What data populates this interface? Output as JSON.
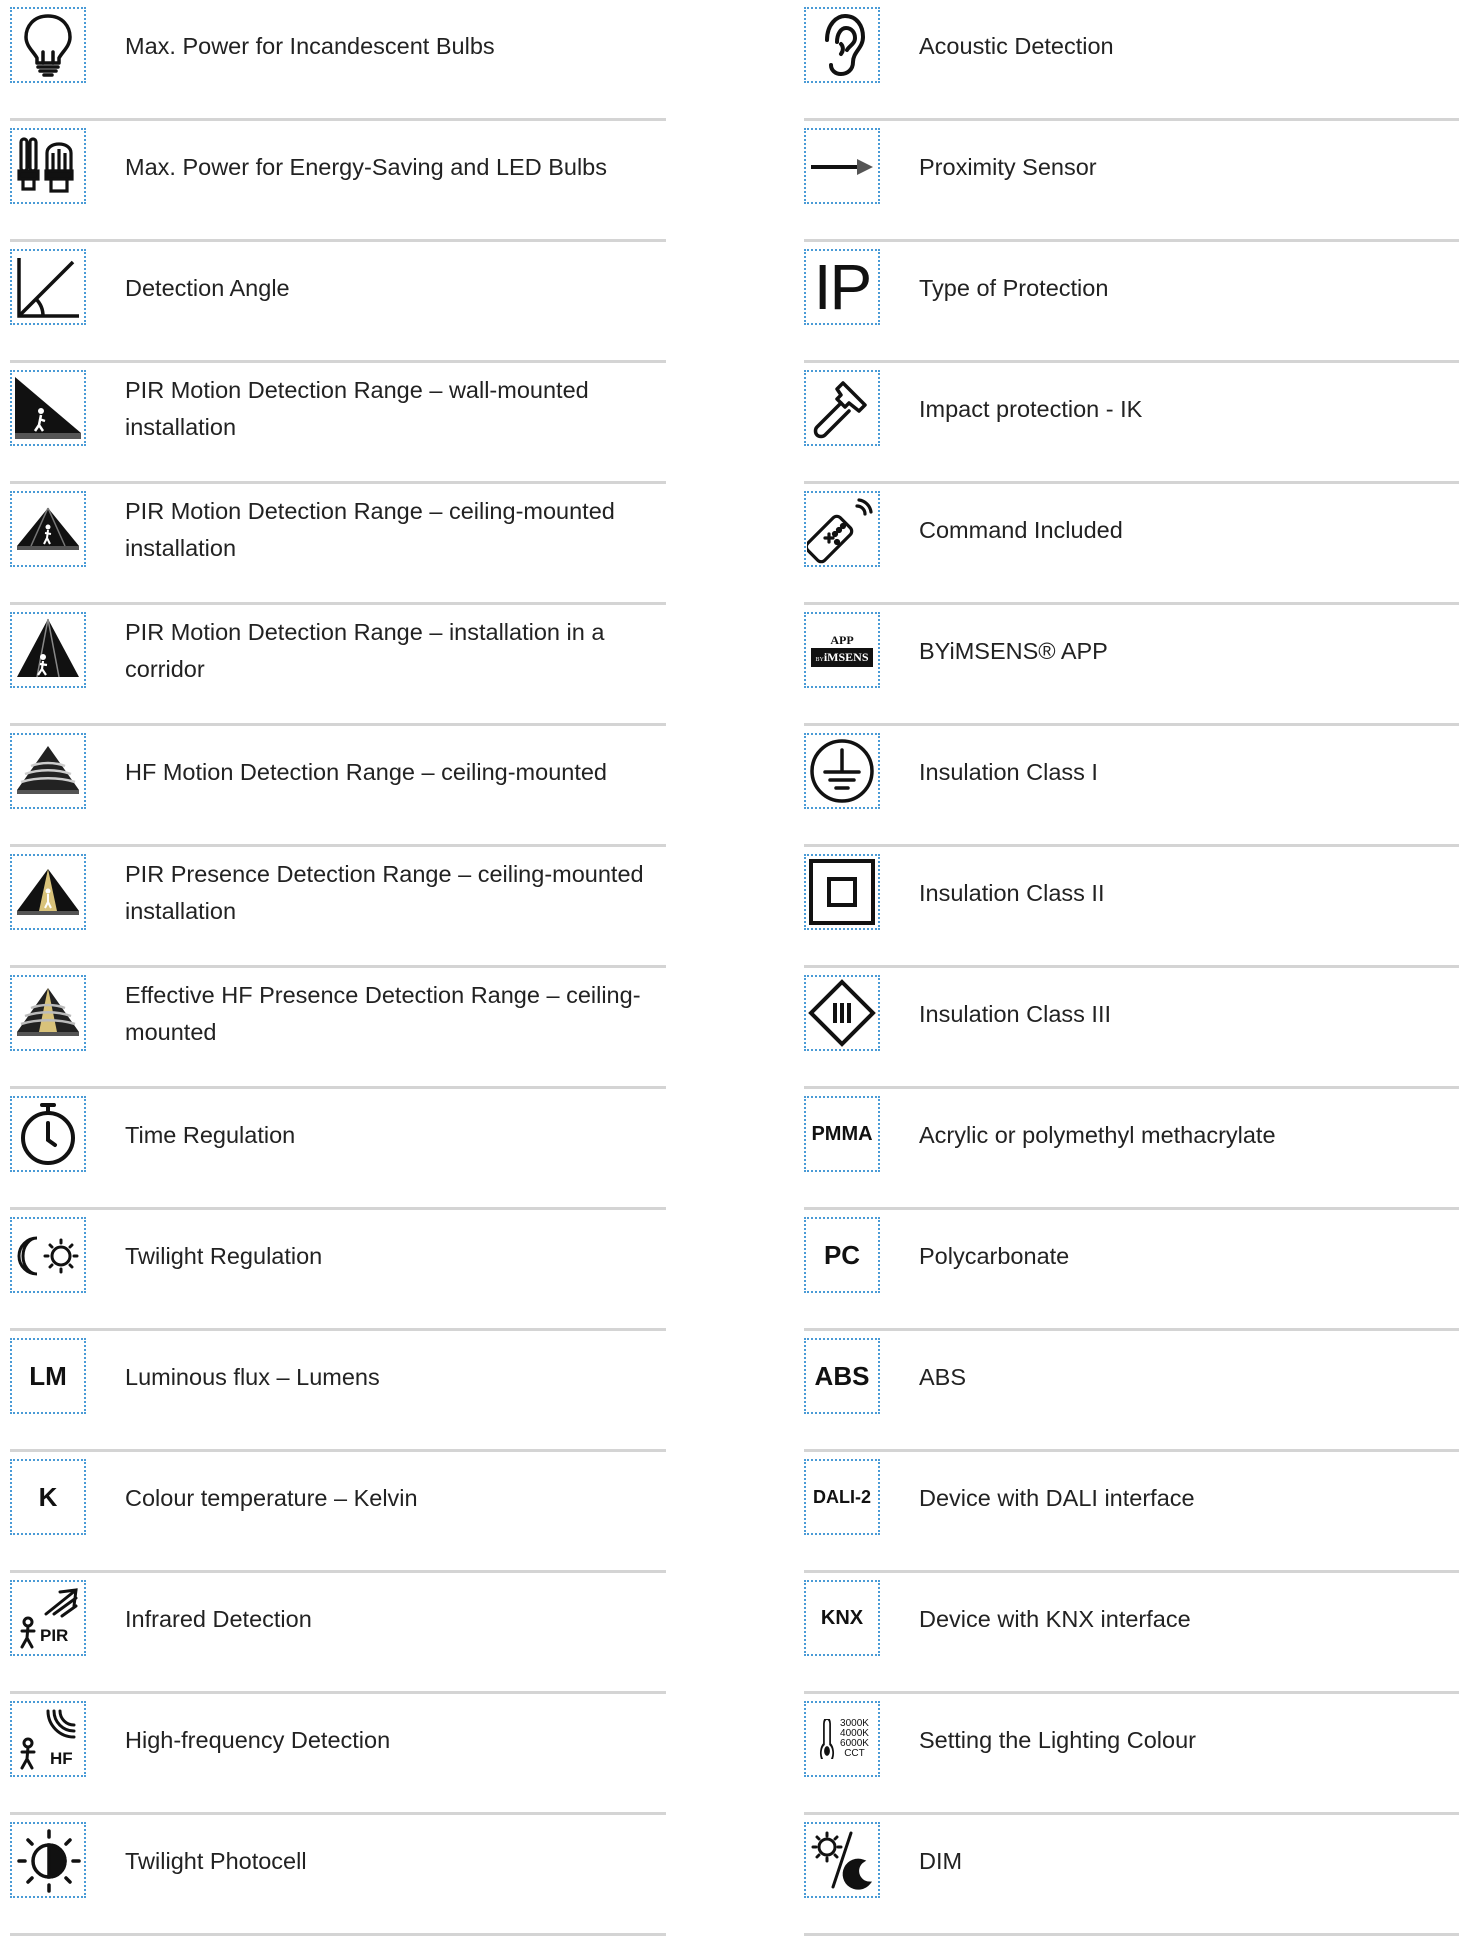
{
  "left_column": [
    {
      "label": "Max. Power for Incandescent Bulbs",
      "icon": "incandescent-bulb-icon"
    },
    {
      "label": "Max. Power for Energy-Saving and LED Bulbs",
      "icon": "energy-saving-bulbs-icon"
    },
    {
      "label": "Detection Angle",
      "icon": "detection-angle-icon"
    },
    {
      "label": "PIR Motion Detection Range – wall-mounted installation",
      "icon": "pir-wall-range-icon"
    },
    {
      "label": "PIR Motion Detection Range – ceiling-mounted installation",
      "icon": "pir-ceiling-range-icon"
    },
    {
      "label": "PIR Motion Detection Range – installation in a corridor",
      "icon": "pir-corridor-range-icon"
    },
    {
      "label": "HF Motion Detection Range – ceiling-mounted",
      "icon": "hf-motion-range-icon"
    },
    {
      "label": "PIR Presence Detection Range – ceiling-mounted installation",
      "icon": "pir-presence-range-icon"
    },
    {
      "label": "Effective HF Presence Detection Range – ceiling-mounted",
      "icon": "hf-presence-range-icon"
    },
    {
      "label": "Time Regulation",
      "icon": "stopwatch-icon"
    },
    {
      "label": "Twilight Regulation",
      "icon": "moon-sun-icon"
    },
    {
      "label": "Luminous flux – Lumens",
      "icon": "lm-text-icon",
      "icon_text": "LM"
    },
    {
      "label": "Colour temperature – Kelvin",
      "icon": "kelvin-text-icon",
      "icon_text": "K"
    },
    {
      "label": "Infrared Detection",
      "icon": "pir-detection-icon",
      "icon_text": "PIR"
    },
    {
      "label": "High-frequency Detection",
      "icon": "hf-detection-icon",
      "icon_text": "HF"
    },
    {
      "label": "Twilight Photocell",
      "icon": "photocell-icon"
    }
  ],
  "right_column": [
    {
      "label": "Acoustic Detection",
      "icon": "ear-icon"
    },
    {
      "label": "Proximity Sensor",
      "icon": "proximity-arrow-icon"
    },
    {
      "label": "Type of Protection",
      "icon": "ip-text-icon",
      "icon_text": "IP"
    },
    {
      "label": "Impact protection - IK",
      "icon": "hammer-icon"
    },
    {
      "label": "Command Included",
      "icon": "remote-control-icon"
    },
    {
      "label": "BYiMSENS® APP",
      "icon": "app-badge-icon",
      "icon_text_top": "APP",
      "icon_text_bottom": "iMSENS",
      "icon_text_prefix": "BY"
    },
    {
      "label": "Insulation Class I",
      "icon": "earth-ground-icon"
    },
    {
      "label": "Insulation Class II",
      "icon": "double-square-icon"
    },
    {
      "label": "Insulation Class III",
      "icon": "diamond-bars-icon"
    },
    {
      "label": "Acrylic or polymethyl methacrylate",
      "icon": "pmma-text-icon",
      "icon_text": "PMMA"
    },
    {
      "label": "Polycarbonate",
      "icon": "pc-text-icon",
      "icon_text": "PC"
    },
    {
      "label": "ABS",
      "icon": "abs-text-icon",
      "icon_text": "ABS"
    },
    {
      "label": "Device with DALI interface",
      "icon": "dali-text-icon",
      "icon_text": "DALI-2"
    },
    {
      "label": "Device with KNX interface",
      "icon": "knx-text-icon",
      "icon_text": "KNX"
    },
    {
      "label": "Setting the Lighting Colour",
      "icon": "cct-thermometer-icon",
      "icon_lines": [
        "3000K",
        "4000K",
        "6000K",
        "CCT"
      ]
    },
    {
      "label": "DIM",
      "icon": "dim-sun-moon-icon"
    }
  ]
}
